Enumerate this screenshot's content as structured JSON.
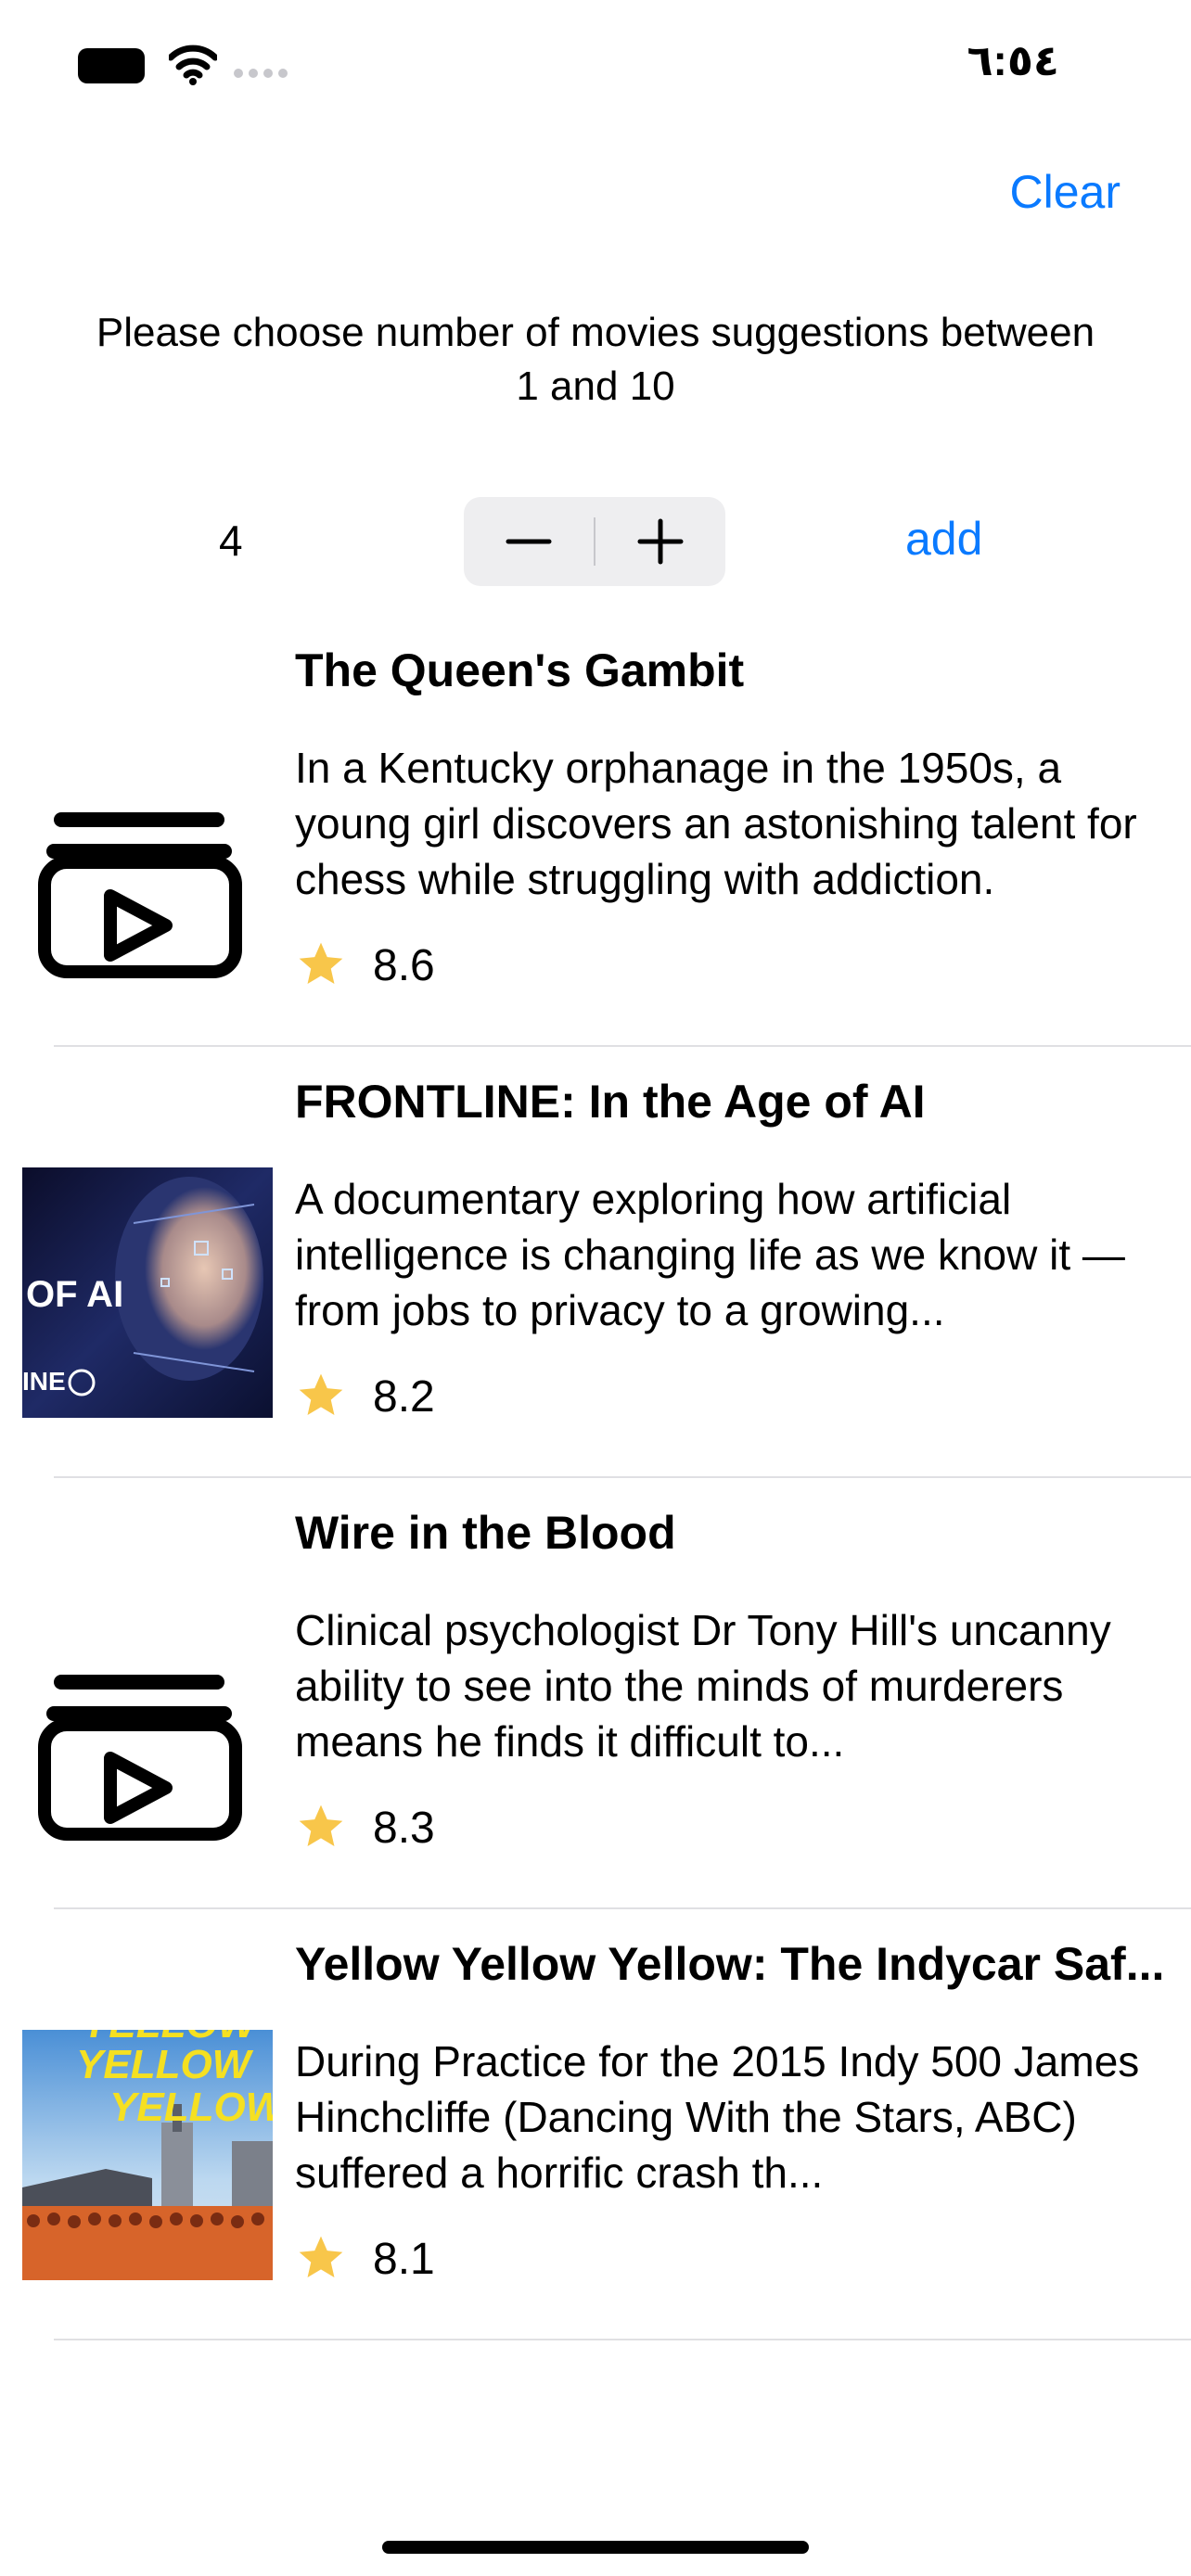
{
  "status_bar": {
    "time": "٦:٥٤",
    "icons": [
      "battery-icon",
      "wifi-icon",
      "cellular-signal-icon"
    ]
  },
  "toolbar": {
    "clear_label": "Clear"
  },
  "prompt": {
    "text": "Please choose number of movies suggestions between 1 and 10"
  },
  "controls": {
    "count": "4",
    "stepper": {
      "minus_icon": "minus-icon",
      "plus_icon": "plus-icon"
    },
    "add_label": "add"
  },
  "colors": {
    "accent": "#0a7aff",
    "star": "#f8c64a",
    "separator": "#e0e0e3",
    "stepper_bg": "#eeeef0"
  },
  "movies": [
    {
      "title": "The Queen's Gambit",
      "description": "In a Kentucky orphanage in the 1950s, a young girl discovers an astonishing talent for chess while struggling with addiction.",
      "rating": "8.6",
      "thumbnail": "video-library-icon"
    },
    {
      "title": "FRONTLINE: In the Age of AI",
      "description": "A documentary exploring how artificial intelligence is changing life as we know it — from jobs to privacy to a growing...",
      "rating": "8.2",
      "thumbnail": "poster-image",
      "poster_text": "OF AI",
      "poster_subtext": "INE"
    },
    {
      "title": "Wire in the Blood",
      "description": "Clinical psychologist Dr Tony Hill's uncanny ability to see into the minds of murderers means he finds it difficult to...",
      "rating": "8.3",
      "thumbnail": "video-library-icon"
    },
    {
      "title": "Yellow Yellow Yellow: The Indycar Saf...",
      "description": "During Practice for the 2015 Indy 500 James Hinchcliffe (Dancing With the Stars, ABC) suffered a horrific crash th...",
      "rating": "8.1",
      "thumbnail": "poster-image",
      "poster_text": "YELLOW"
    }
  ]
}
